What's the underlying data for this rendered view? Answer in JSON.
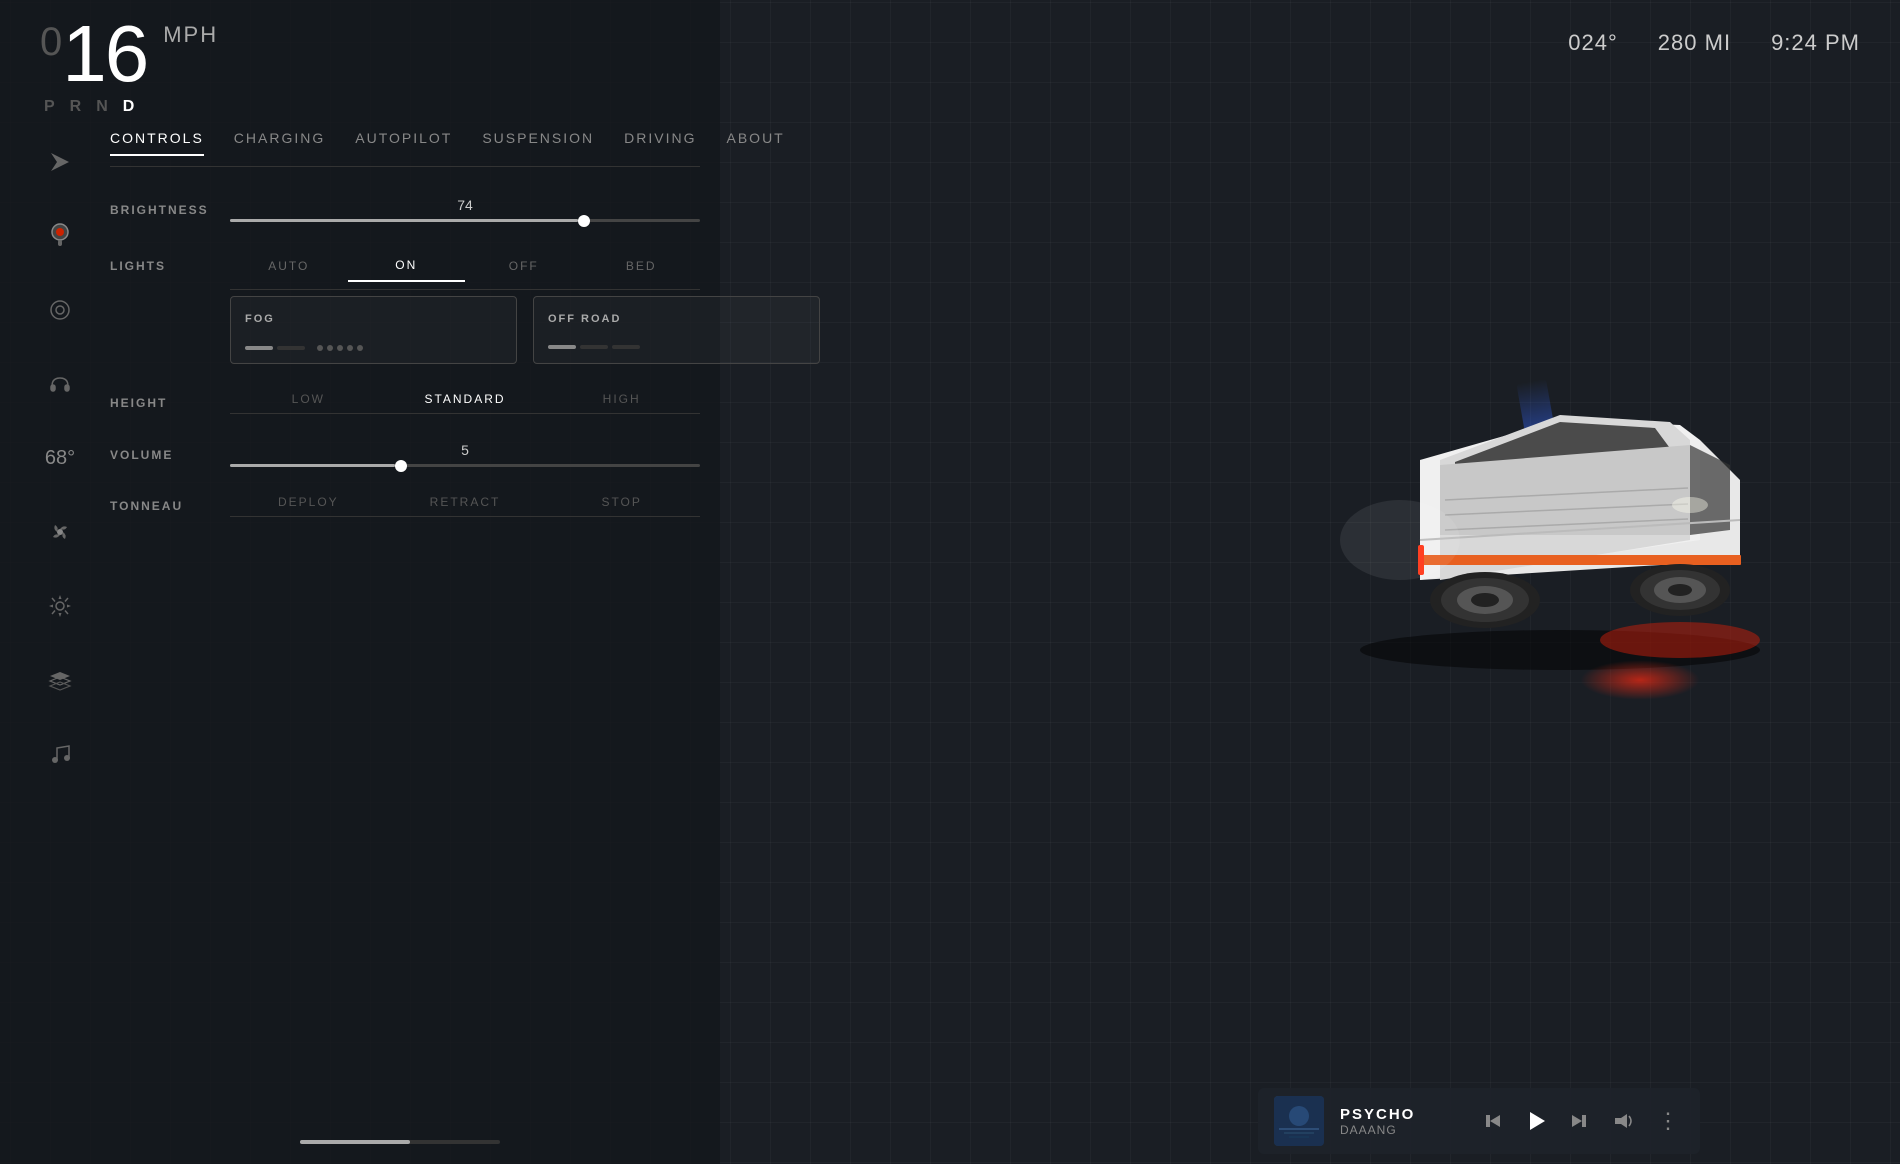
{
  "header": {
    "speed": "16",
    "speed_prefix": "0",
    "speed_unit": "MPH",
    "gears": [
      "P",
      "R",
      "N",
      "D"
    ],
    "active_gear": "D",
    "temperature": "024°",
    "range": "280 MI",
    "time": "9:24 PM"
  },
  "sidebar": {
    "icons": [
      {
        "name": "navigation-icon",
        "symbol": "◄",
        "active": false
      },
      {
        "name": "joystick-icon",
        "symbol": "🎮",
        "active": true,
        "red": false
      },
      {
        "name": "chat-icon",
        "symbol": "◯",
        "active": false
      },
      {
        "name": "headset-icon",
        "symbol": "⌾",
        "active": false
      },
      {
        "name": "temperature-display",
        "symbol": "68°",
        "active": false
      },
      {
        "name": "fan-icon",
        "symbol": "✳",
        "active": false
      },
      {
        "name": "settings-icon",
        "symbol": "⊙",
        "active": false
      },
      {
        "name": "layers-icon",
        "symbol": "≡",
        "active": false
      },
      {
        "name": "music-icon",
        "symbol": "♪",
        "active": false
      }
    ]
  },
  "tabs": [
    {
      "label": "CONTROLS",
      "active": true
    },
    {
      "label": "CHARGING",
      "active": false
    },
    {
      "label": "AUTOPILOT",
      "active": false
    },
    {
      "label": "SUSPENSION",
      "active": false
    },
    {
      "label": "DRIVING",
      "active": false
    },
    {
      "label": "ABOUT",
      "active": false
    }
  ],
  "brightness": {
    "label": "BRIGHTNESS",
    "value": 74,
    "percent": 74
  },
  "lights": {
    "label": "LIGHTS",
    "options": [
      "AUTO",
      "ON",
      "OFF",
      "BED"
    ],
    "active": "ON"
  },
  "fog_card": {
    "title": "FOG",
    "bars": [
      true,
      false,
      false,
      false,
      false
    ]
  },
  "offroad_card": {
    "title": "OFF ROAD",
    "bars": [
      true,
      false,
      false
    ]
  },
  "height": {
    "label": "HEIGHT",
    "options": [
      "LOW",
      "STANDARD",
      "HIGH"
    ],
    "active": "STANDARD"
  },
  "volume": {
    "label": "VOLUME",
    "value": 5,
    "percent": 35
  },
  "tonneau": {
    "label": "TONNEAU",
    "options": [
      "DEPLOY",
      "RETRACT",
      "STOP"
    ]
  },
  "music_player": {
    "song": "PSYCHO",
    "artist": "DAAANG",
    "controls": {
      "prev": "⏮",
      "play": "▶",
      "next": "⏭",
      "volume": "🔊",
      "more": "⋮"
    }
  }
}
